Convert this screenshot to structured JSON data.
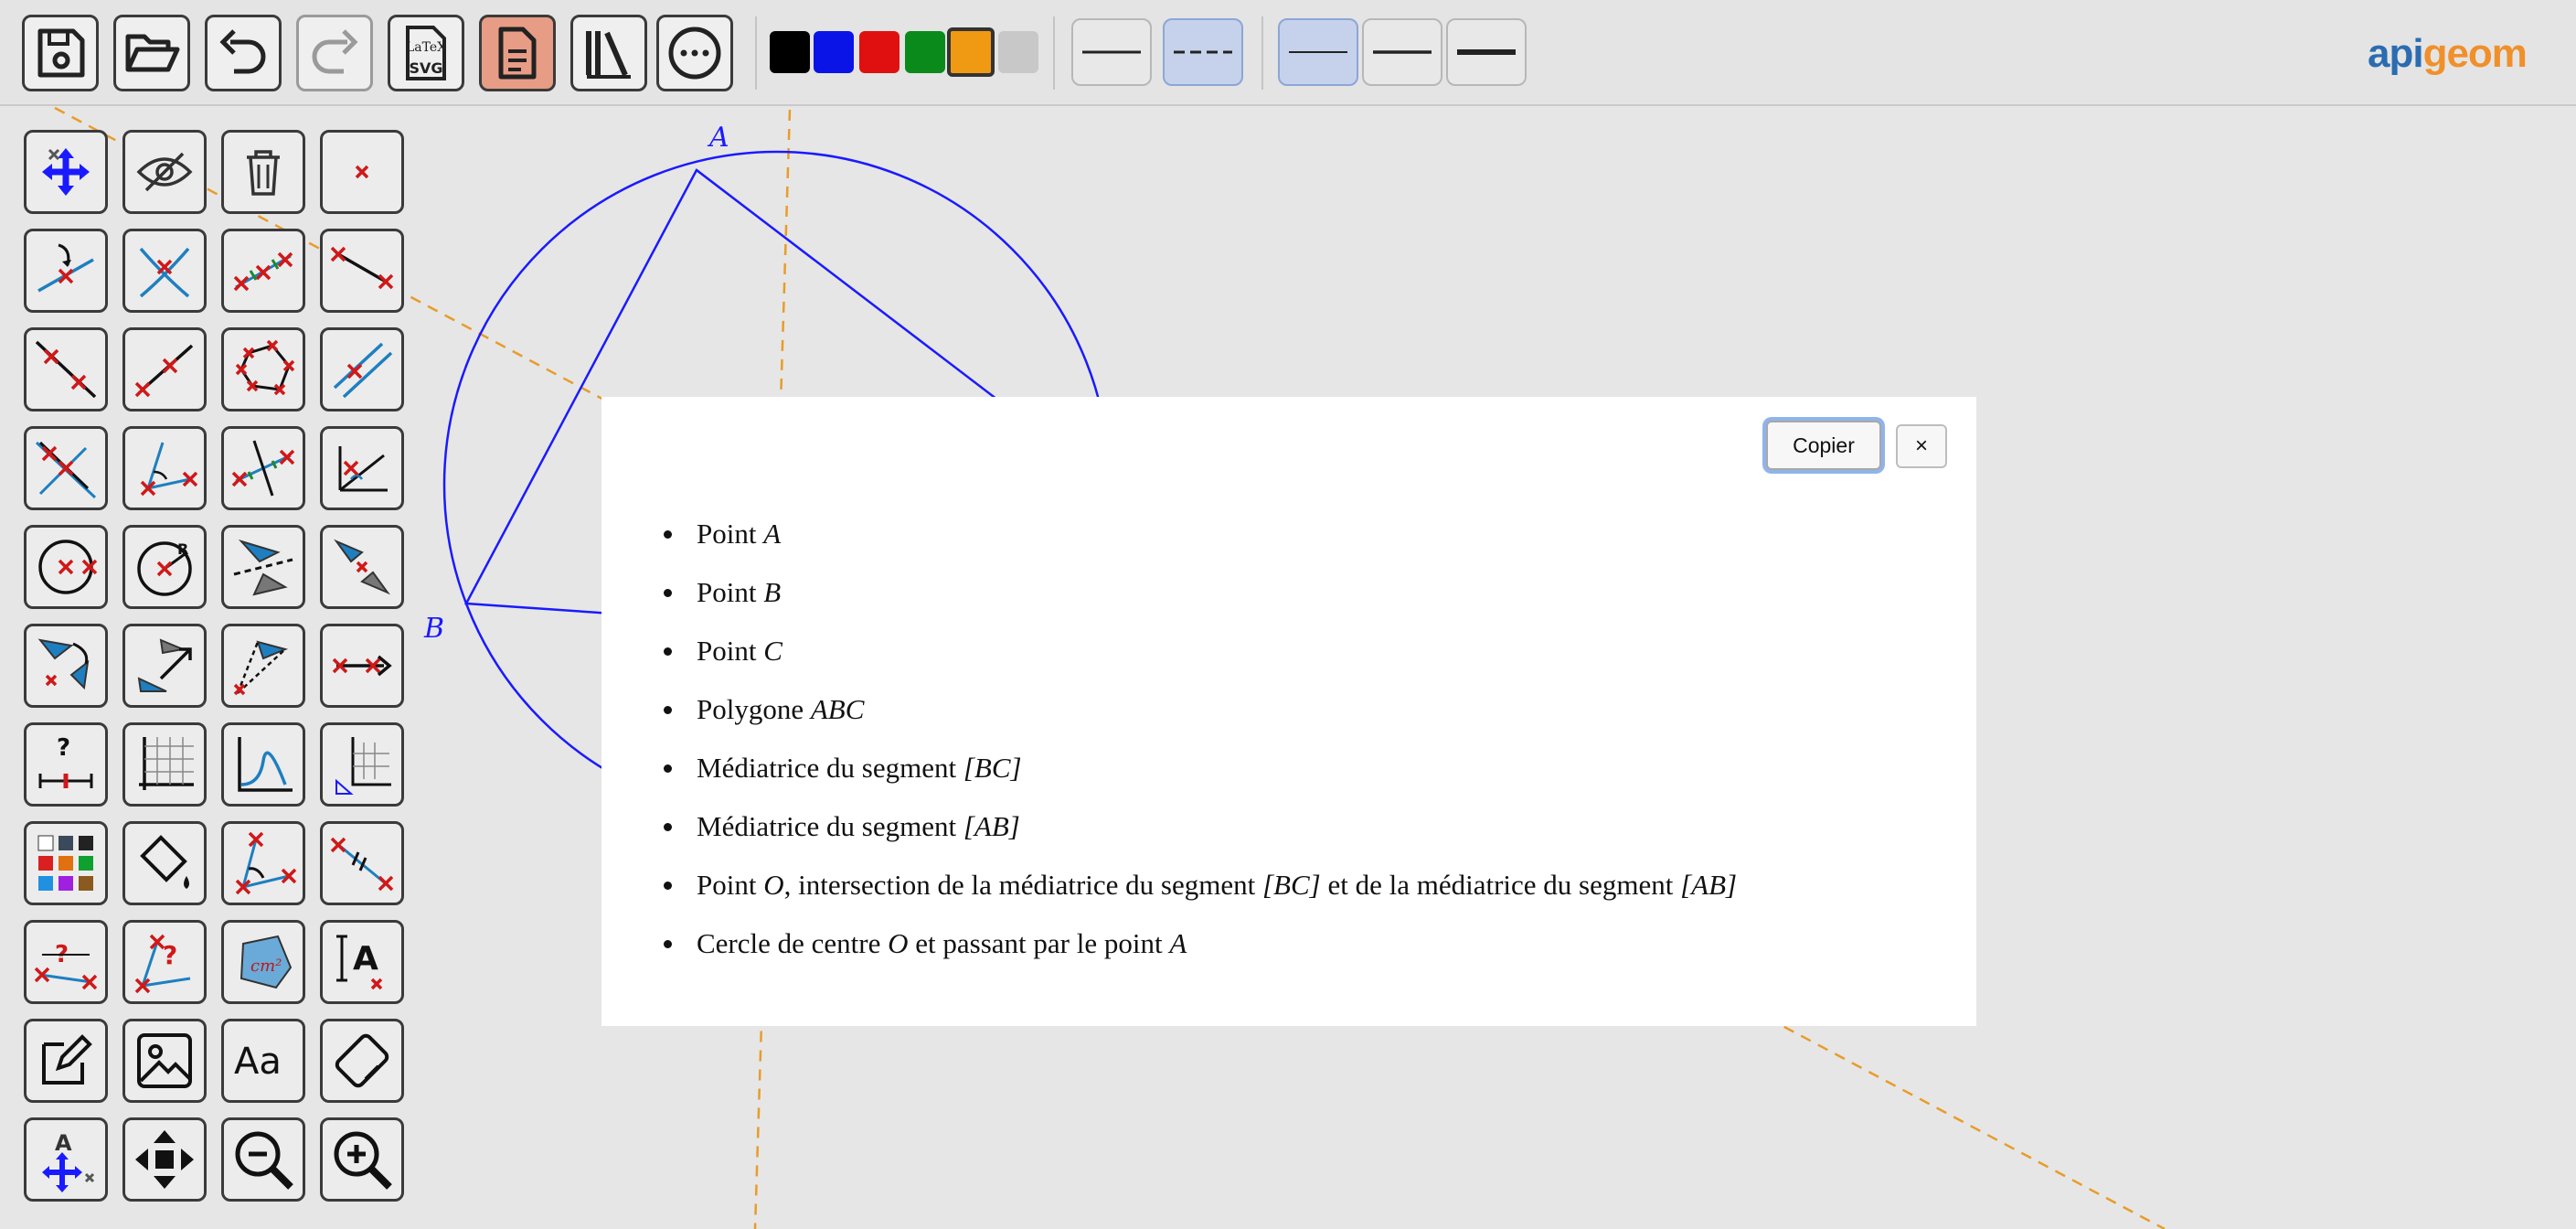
{
  "app": {
    "logo_part1": "api",
    "logo_part2": "geom"
  },
  "toolbar": {
    "file_buttons": [
      {
        "name": "save-icon"
      },
      {
        "name": "open-folder-icon"
      },
      {
        "name": "undo-icon"
      },
      {
        "name": "redo-icon",
        "disabled": true
      },
      {
        "name": "export-latex-svg-icon"
      },
      {
        "name": "document-icon",
        "active": true
      },
      {
        "name": "library-icon"
      },
      {
        "name": "more-icon"
      }
    ],
    "colors": [
      "#000000",
      "#0a14e6",
      "#e01010",
      "#0a8a1a",
      "#f09a14",
      "#c8c8c8"
    ],
    "selected_color": "#f09a14",
    "line_styles": [
      "solid",
      "dashed"
    ],
    "selected_line_style": "dashed",
    "line_widths": [
      "thin",
      "medium",
      "thick"
    ],
    "selected_line_width": "thin"
  },
  "figure": {
    "points": [
      {
        "label": "A"
      },
      {
        "label": "B"
      }
    ]
  },
  "dialog": {
    "copy_label": "Copier",
    "close_label": "×",
    "steps": [
      {
        "text": "Point ",
        "math": "A",
        "rest": ""
      },
      {
        "text": "Point ",
        "math": "B",
        "rest": ""
      },
      {
        "text": "Point ",
        "math": "C",
        "rest": ""
      },
      {
        "text": "Polygone ",
        "math": "ABC",
        "rest": ""
      },
      {
        "text": "Médiatrice du segment ",
        "math": "[BC]",
        "rest": ""
      },
      {
        "text": "Médiatrice du segment ",
        "math": "[AB]",
        "rest": ""
      },
      {
        "text": "Point ",
        "math": "O",
        "rest": ", intersection de la médiatrice du segment ",
        "math2": "[BC]",
        "rest2": " et de la médiatrice du segment ",
        "math3": "[AB]"
      },
      {
        "text": "Cercle de centre ",
        "math": "O",
        "rest": " et passant par le point ",
        "math2": "A"
      }
    ]
  },
  "tools": [
    "move-point-icon",
    "hide-icon",
    "delete-icon",
    "close-icon",
    "point-on-line-icon",
    "intersection-icon",
    "midpoint-icon",
    "segment-icon",
    "line-icon",
    "half-line-icon",
    "polygon-icon",
    "parallel-icon",
    "perpendicular-icon",
    "angle-icon",
    "perpendicular-bisector-icon",
    "angle-bisector-icon",
    "circle-center-point-icon",
    "circle-radius-icon",
    "reflection-line-icon",
    "reflection-point-icon",
    "rotation-icon",
    "translation-icon",
    "homothety-icon",
    "vector-icon",
    "measure-length-icon",
    "grid-icon",
    "function-graph-icon",
    "axes-icon",
    "color-palette-icon",
    "fill-icon",
    "angle-mark-icon",
    "equal-length-mark-icon",
    "display-length-icon",
    "display-angle-icon",
    "area-icon",
    "text-label-icon",
    "edit-icon",
    "image-icon",
    "font-icon",
    "eraser-icon",
    "move-label-icon",
    "pan-icon",
    "zoom-out-icon",
    "zoom-in-icon"
  ]
}
